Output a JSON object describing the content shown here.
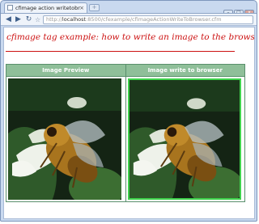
{
  "browser": {
    "tab_title": "cfimage action writetobrow...",
    "tab_close": "×",
    "new_tab": "+",
    "url_scheme": "http://",
    "url_host": "localhost",
    "url_rest": ":8500/cfexample/cfimageActionWriteToBrowser.cfm",
    "window_controls": [
      "–",
      "□",
      "x"
    ],
    "nav": {
      "back": "◀",
      "forward": "▶",
      "reload": "↻",
      "star": "☆"
    }
  },
  "page": {
    "title": "cfimage tag example: how to write an image to the browser",
    "table": {
      "headers": [
        "Image Preview",
        "Image write to browser"
      ]
    }
  },
  "colors": {
    "title_red": "#cc1111",
    "header_green": "#8fbf99",
    "frame_green": "#3fd24c"
  }
}
